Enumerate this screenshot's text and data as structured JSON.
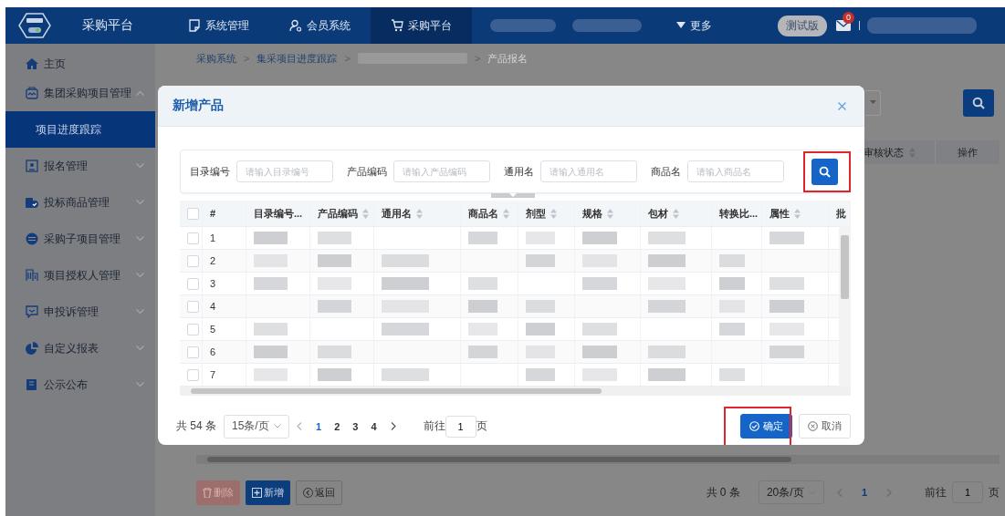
{
  "header": {
    "brand": "采购平台",
    "nav": [
      {
        "label": "系统管理",
        "selected": false
      },
      {
        "label": "会员系统",
        "selected": false
      },
      {
        "label": "采购平台",
        "selected": true
      }
    ],
    "more": "更多",
    "edition_badge": "测试版",
    "mail_count": "0"
  },
  "sidebar": {
    "items": [
      {
        "label": "主页",
        "selected": false
      },
      {
        "label": "集团采购项目管理",
        "selected": false,
        "expanded": true,
        "children": [
          {
            "label": "项目进度跟踪",
            "selected": true
          }
        ]
      },
      {
        "label": "报名管理",
        "selected": false,
        "expanded": false
      },
      {
        "label": "投标商品管理",
        "selected": false,
        "expanded": false
      },
      {
        "label": "采购子项目管理",
        "selected": false,
        "expanded": false
      },
      {
        "label": "项目授权人管理",
        "selected": false,
        "expanded": false
      },
      {
        "label": "申投诉管理",
        "selected": false,
        "expanded": false
      },
      {
        "label": "自定义报表",
        "selected": false,
        "expanded": false
      },
      {
        "label": "公示公布",
        "selected": false,
        "expanded": false
      }
    ]
  },
  "breadcrumb": [
    {
      "kind": "link",
      "label": "采购系统"
    },
    {
      "kind": "separator",
      "label": ">"
    },
    {
      "kind": "link",
      "label": "集采项目进度跟踪"
    },
    {
      "kind": "separator",
      "label": ">"
    },
    {
      "kind": "redacted"
    },
    {
      "kind": "separator",
      "label": ">"
    },
    {
      "kind": "current",
      "label": "产品报名"
    }
  ],
  "background_table": {
    "columns": [
      {
        "label": "审核状态",
        "sortable": true
      },
      {
        "label": "操作",
        "sortable": false
      }
    ]
  },
  "background_footer": {
    "buttons": [
      {
        "label": "删除",
        "kind": "delete",
        "disabled": true
      },
      {
        "label": "新增",
        "kind": "add",
        "disabled": false
      },
      {
        "label": "返回",
        "kind": "back",
        "disabled": false
      }
    ],
    "total": "共 0 条",
    "page_size": "20条/页",
    "pages": [
      {
        "label": "1",
        "selected": true
      }
    ],
    "goto_label": "前往",
    "goto_value": "1",
    "goto_suffix": "页"
  },
  "dialog": {
    "title": "新增产品",
    "filters": [
      {
        "label": "目录编号",
        "placeholder": "请输入目录编号"
      },
      {
        "label": "产品编码",
        "placeholder": "请输入产品编码"
      },
      {
        "label": "通用名",
        "placeholder": "请输入通用名"
      },
      {
        "label": "商品名",
        "placeholder": "请输入商品名"
      }
    ],
    "search_highlighted": true,
    "all_checked": false,
    "columns": [
      {
        "label": "#",
        "sortable": false
      },
      {
        "label": "目录编号...",
        "sortable": false
      },
      {
        "label": "产品编码",
        "sortable": true
      },
      {
        "label": "通用名",
        "sortable": true
      },
      {
        "label": "商品名",
        "sortable": true
      },
      {
        "label": "剂型",
        "sortable": true
      },
      {
        "label": "规格",
        "sortable": true
      },
      {
        "label": "包材",
        "sortable": true
      },
      {
        "label": "转换比...",
        "sortable": false
      },
      {
        "label": "属性",
        "sortable": true
      },
      {
        "label": "批",
        "sortable": false
      }
    ],
    "rows": [
      {
        "index": "1",
        "checked": false
      },
      {
        "index": "2",
        "checked": false
      },
      {
        "index": "3",
        "checked": false
      },
      {
        "index": "4",
        "checked": false
      },
      {
        "index": "5",
        "checked": false
      },
      {
        "index": "6",
        "checked": false
      },
      {
        "index": "7",
        "checked": false
      }
    ],
    "footer": {
      "total": "共 54 条",
      "page_size": "15条/页",
      "pages": [
        {
          "label": "1",
          "selected": true
        },
        {
          "label": "2",
          "selected": false
        },
        {
          "label": "3",
          "selected": false
        },
        {
          "label": "4",
          "selected": false
        }
      ],
      "goto_label": "前往",
      "goto_value": "1",
      "goto_suffix": "页"
    },
    "buttons": [
      {
        "label": "确定",
        "kind": "primary",
        "highlighted": true
      },
      {
        "label": "取消",
        "kind": "default",
        "highlighted": false
      }
    ]
  }
}
